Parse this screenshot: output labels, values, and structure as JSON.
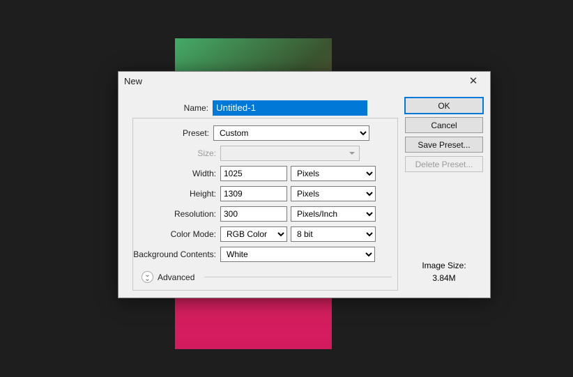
{
  "dialog": {
    "title": "New",
    "name_label": "Name:",
    "name_value": "Untitled-1",
    "preset_label": "Preset:",
    "preset_value": "Custom",
    "size_label": "Size:",
    "width_label": "Width:",
    "width_value": "1025",
    "width_unit": "Pixels",
    "height_label": "Height:",
    "height_value": "1309",
    "height_unit": "Pixels",
    "resolution_label": "Resolution:",
    "resolution_value": "300",
    "resolution_unit": "Pixels/Inch",
    "color_mode_label": "Color Mode:",
    "color_mode_value": "RGB Color",
    "bit_depth_value": "8 bit",
    "background_label": "Background Contents:",
    "background_value": "White",
    "advanced_label": "Advanced",
    "image_size_label": "Image Size:",
    "image_size_value": "3.84M"
  },
  "buttons": {
    "ok": "OK",
    "cancel": "Cancel",
    "save_preset": "Save Preset...",
    "delete_preset": "Delete Preset..."
  }
}
